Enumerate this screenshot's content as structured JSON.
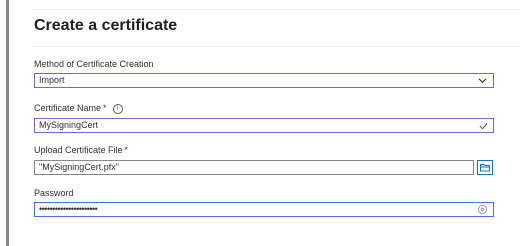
{
  "dialog": {
    "title": "Create a certificate"
  },
  "method": {
    "label": "Method of Certificate Creation",
    "value": "Import"
  },
  "cert_name": {
    "label": "Certificate Name",
    "required_mark": "*",
    "value": "MySigningCert"
  },
  "upload": {
    "label": "Upload Certificate File",
    "required_mark": "*",
    "value": "\"MySigningCert.pfx\""
  },
  "password": {
    "label": "Password",
    "value": "••••••••••••••••••••••"
  },
  "colors": {
    "focused_border": "#3b78d8",
    "select_border": "#8661c5",
    "required": "#a4262c",
    "accent": "#0078d4",
    "valid_check": "#107c10"
  },
  "icons": [
    "info-icon",
    "chevron-down-icon",
    "checkmark-icon",
    "folder-icon",
    "eye-reveal-icon"
  ]
}
